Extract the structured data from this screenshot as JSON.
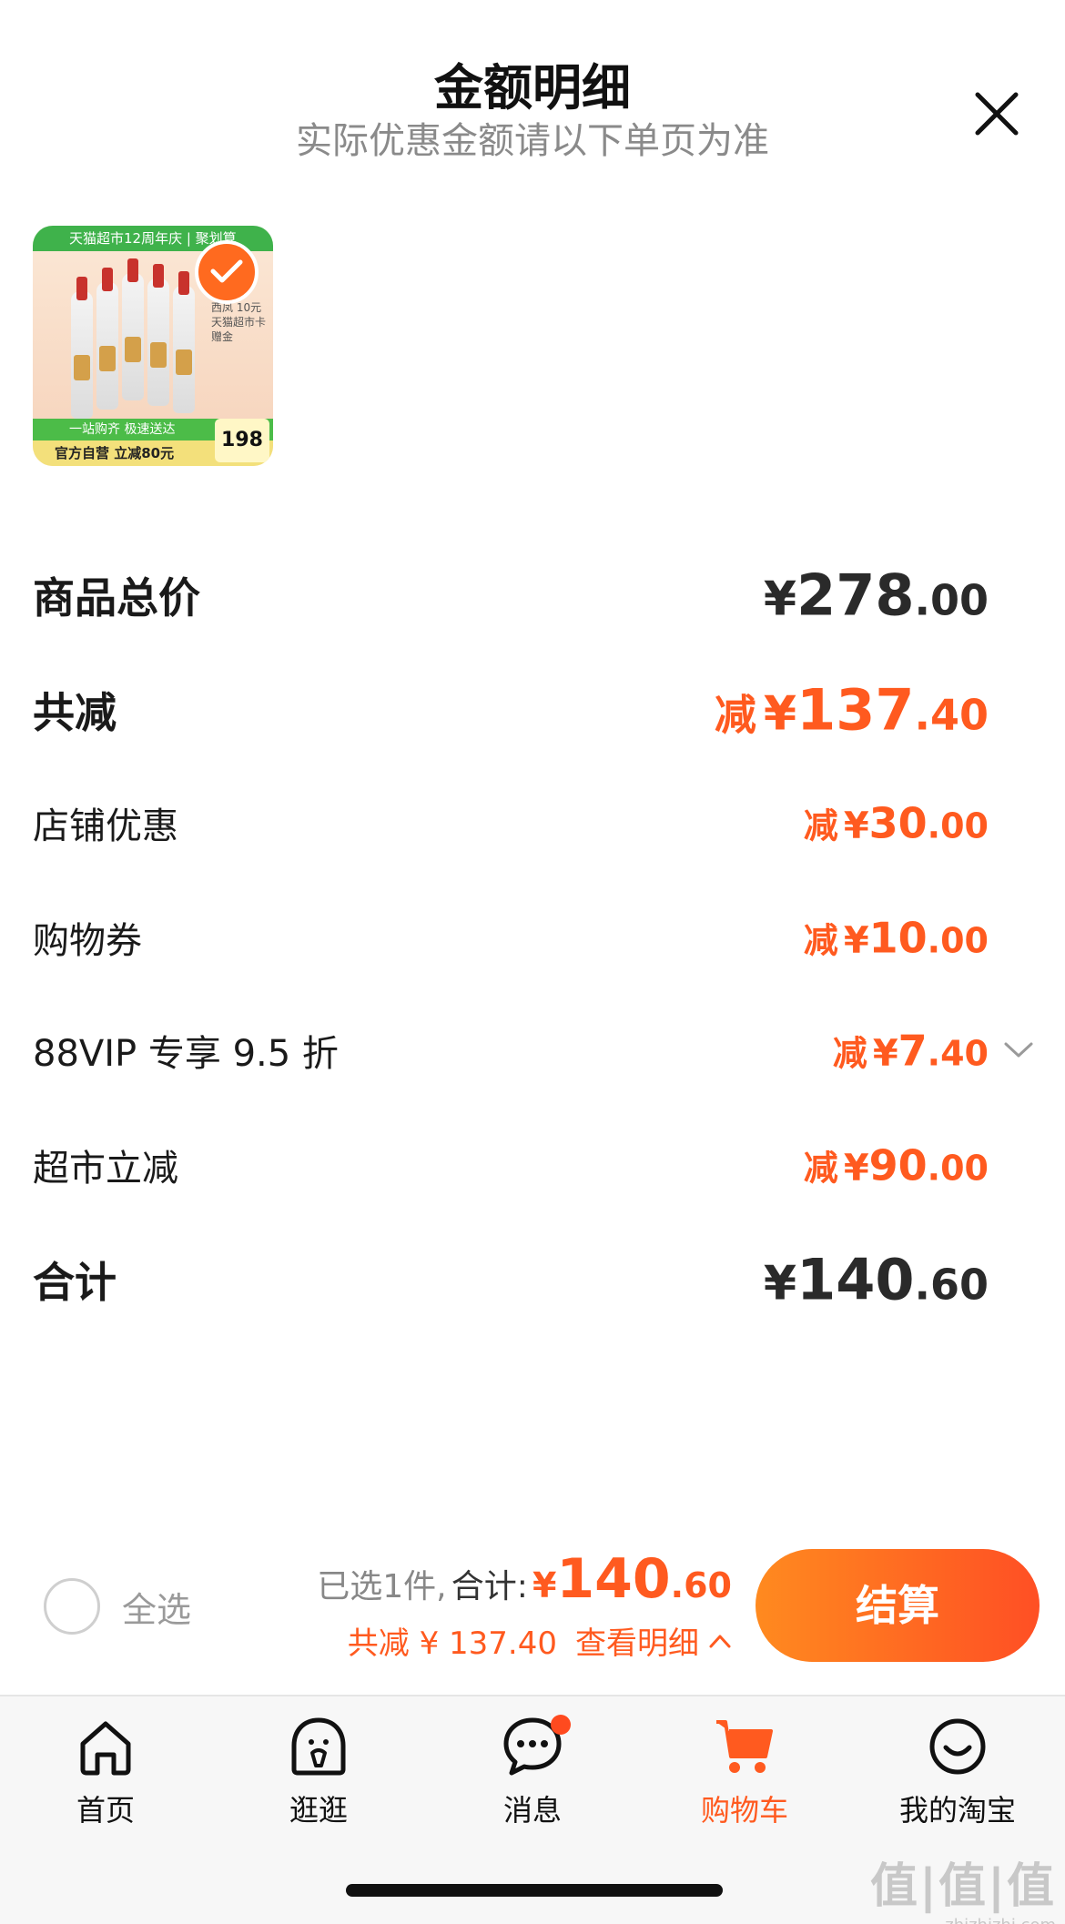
{
  "sheet": {
    "title": "金额明细",
    "subtitle": "实际优惠金额请以下单页为准"
  },
  "product": {
    "banner": "天猫超市12周年庆 | 聚划算",
    "side_text": "西凤 10元 天猫超市卡赠金",
    "foot_line1": "一站购齐 极速送达",
    "foot_line2": "官方自营 立减80元",
    "price": "198",
    "checked": true
  },
  "rows": [
    {
      "label": "商品总价",
      "prefix": "",
      "currency": "¥",
      "int": "278",
      "dec": ".00",
      "style": "total",
      "color": "#2a2a2a"
    },
    {
      "label": "共减",
      "prefix": "减",
      "currency": "¥",
      "int": "137",
      "dec": ".40",
      "style": "total",
      "color": "#ff5a1f"
    },
    {
      "label": "店铺优惠",
      "prefix": "减",
      "currency": "¥",
      "int": "30",
      "dec": ".00",
      "style": "item",
      "color": "#ff5a1f"
    },
    {
      "label": "购物券",
      "prefix": "减",
      "currency": "¥",
      "int": "10",
      "dec": ".00",
      "style": "item",
      "color": "#ff5a1f"
    },
    {
      "label": "88VIP 专享 9.5 折",
      "prefix": "减",
      "currency": "¥",
      "int": "7",
      "dec": ".40",
      "style": "item",
      "color": "#ff5a1f",
      "expandable": true
    },
    {
      "label": "超市立减",
      "prefix": "减",
      "currency": "¥",
      "int": "90",
      "dec": ".00",
      "style": "item",
      "color": "#ff5a1f"
    },
    {
      "label": "合计",
      "prefix": "",
      "currency": "¥",
      "int": "140",
      "dec": ".60",
      "style": "total",
      "color": "#2a2a2a"
    }
  ],
  "bottom_bar": {
    "select_all": "全选",
    "selected_text": "已选1件,",
    "total_label": "合计:",
    "total_currency": "¥",
    "total_int": "140",
    "total_dec": ".60",
    "saved_text": "共减 ¥ 137.40",
    "view_detail": "查看明细",
    "checkout": "结算"
  },
  "tabs": [
    {
      "label": "首页",
      "icon": "home-icon",
      "active": false
    },
    {
      "label": "逛逛",
      "icon": "stroll-icon",
      "active": false
    },
    {
      "label": "消息",
      "icon": "message-icon",
      "active": false,
      "badge_dot": true
    },
    {
      "label": "购物车",
      "icon": "cart-icon",
      "active": true
    },
    {
      "label": "我的淘宝",
      "icon": "profile-icon",
      "active": false
    }
  ],
  "watermark": {
    "line1": "值|值|值",
    "line2": "zhizhizhi.com"
  },
  "colors": {
    "accent": "#ff5a1f",
    "checkout_start": "#ff8a1f",
    "checkout_end": "#ff4f24",
    "muted": "#8a8a8a"
  }
}
